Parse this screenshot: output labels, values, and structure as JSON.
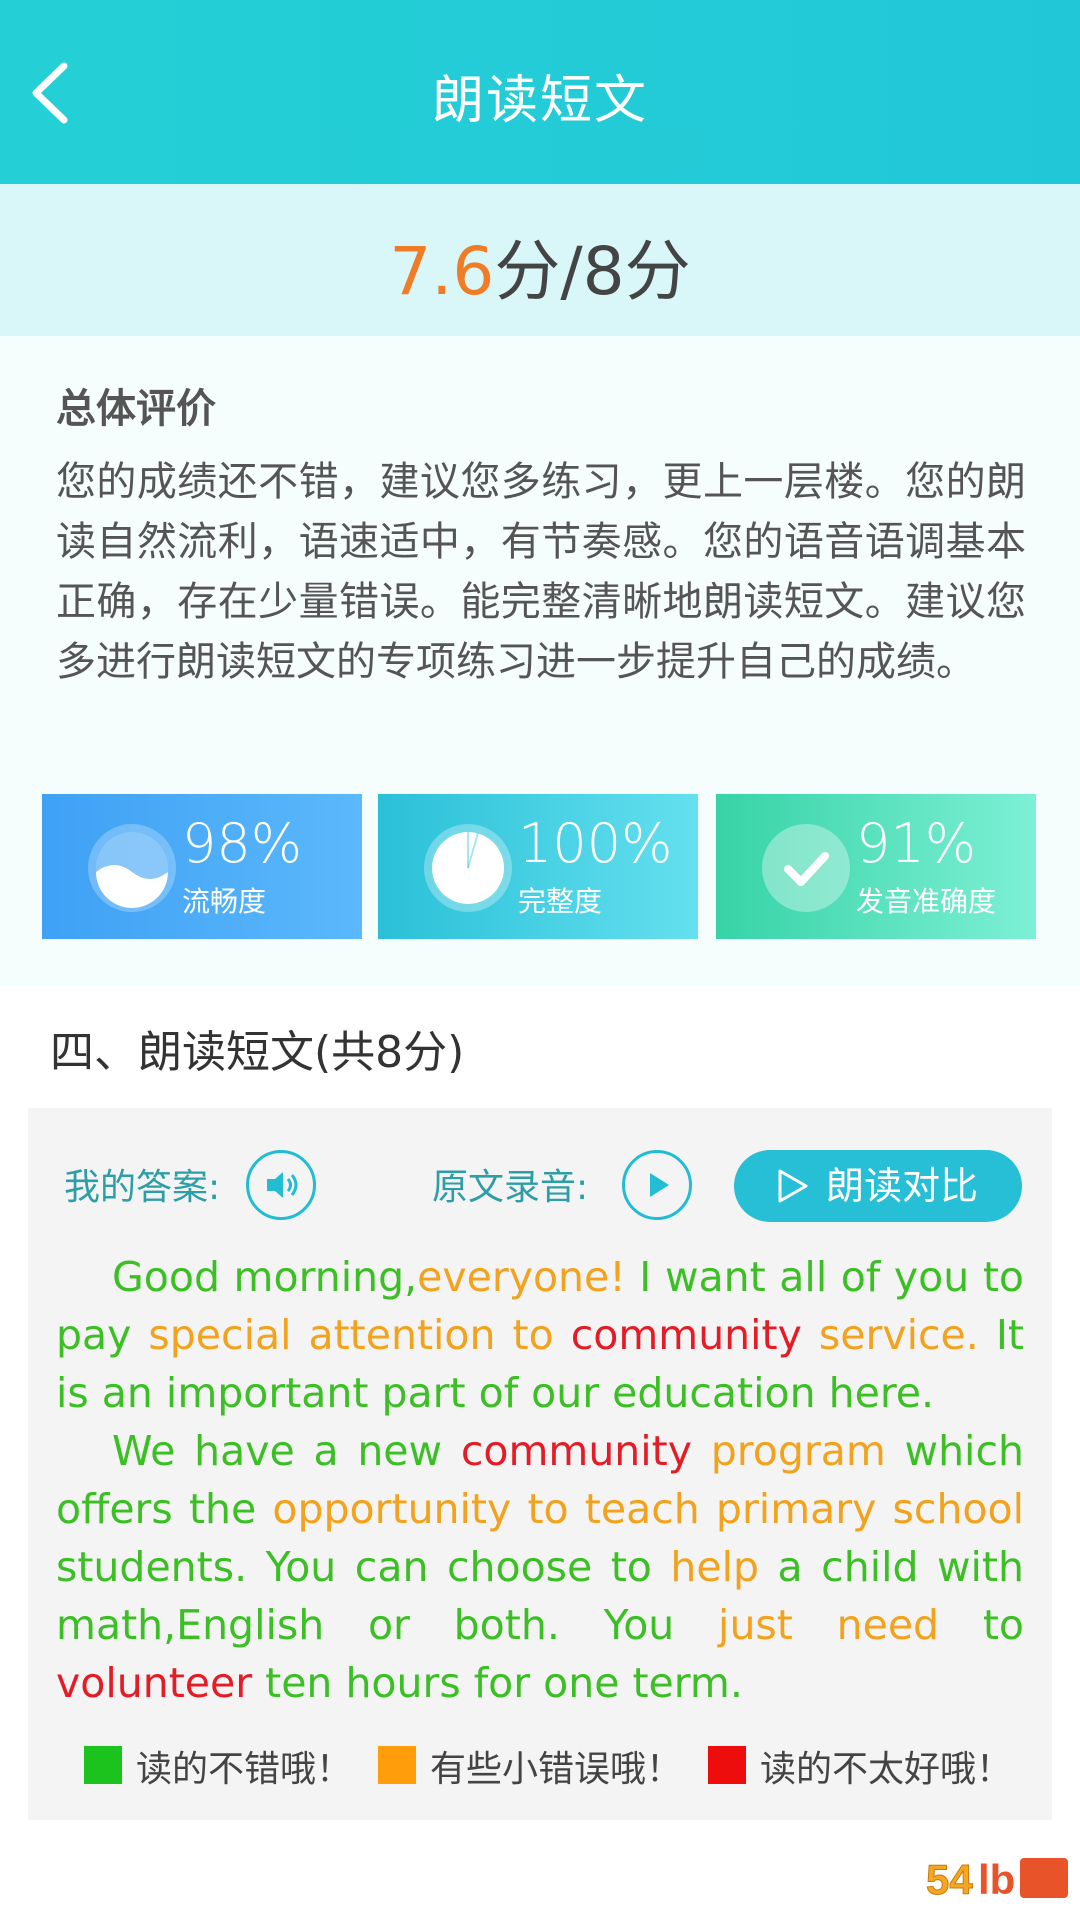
{
  "header": {
    "title": "朗读短文",
    "back_icon": "chevron-left-icon"
  },
  "score": {
    "value": "7.6",
    "suffix": "分/8分"
  },
  "overall": {
    "title": "总体评价",
    "text": "您的成绩还不错，建议您多练习，更上一层楼。您的朗读自然流利，语速适中，有节奏感。您的语音语调基本正确，存在少量错误。能完整清晰地朗读短文。建议您多进行朗读短文的专项练习进一步提升自己的成绩。"
  },
  "metrics": [
    {
      "percent": "98%",
      "label": "流畅度",
      "icon": "wave-icon"
    },
    {
      "percent": "100%",
      "label": "完整度",
      "icon": "pie-icon"
    },
    {
      "percent": "91%",
      "label": "发音准确度",
      "icon": "check-icon"
    }
  ],
  "section": {
    "title": "四、朗读短文(共8分)"
  },
  "controls": {
    "my_answer_label": "我的答案:",
    "original_label": "原文录音:",
    "compare_label": "朗读对比"
  },
  "passage": {
    "paragraphs": [
      [
        {
          "t": "Good morning,",
          "c": "ok"
        },
        {
          "t": "everyone!",
          "c": "minor"
        },
        {
          "t": " I want all of you to pay ",
          "c": "ok"
        },
        {
          "t": "special attention to",
          "c": "minor"
        },
        {
          "t": " ",
          "c": "ok"
        },
        {
          "t": "community",
          "c": "bad"
        },
        {
          "t": " ",
          "c": "ok"
        },
        {
          "t": "service.",
          "c": "minor"
        },
        {
          "t": " It is an important part of our education here.",
          "c": "ok"
        }
      ],
      [
        {
          "t": "We have a new ",
          "c": "ok"
        },
        {
          "t": "community",
          "c": "bad"
        },
        {
          "t": " ",
          "c": "ok"
        },
        {
          "t": "program",
          "c": "minor"
        },
        {
          "t": " which offers the ",
          "c": "ok"
        },
        {
          "t": "opportunity to teach  primary school",
          "c": "minor"
        },
        {
          "t": " students. You can choose to ",
          "c": "ok"
        },
        {
          "t": "help",
          "c": "minor"
        },
        {
          "t": " a child with math,English or both. You ",
          "c": "ok"
        },
        {
          "t": "just need",
          "c": "minor"
        },
        {
          "t": " to ",
          "c": "ok"
        },
        {
          "t": "volunteer",
          "c": "bad"
        },
        {
          "t": " ten hours for one term.",
          "c": "ok"
        }
      ]
    ]
  },
  "legend": [
    {
      "label": "读的不错哦！",
      "color": "#1cc31c"
    },
    {
      "label": "有些小错误哦！",
      "color": "#ff9d0a"
    },
    {
      "label": "读的不太好哦！",
      "color": "#ee0d0d"
    }
  ],
  "colors": {
    "ok": "#3bbf25",
    "minor": "#f2a21c",
    "bad": "#e41c26",
    "score": "#f07c25",
    "accent": "#27bfd6"
  }
}
